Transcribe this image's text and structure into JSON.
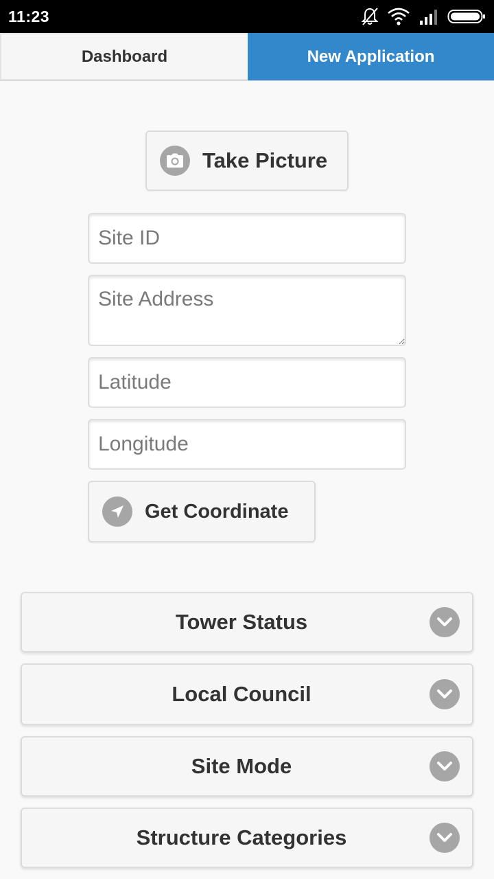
{
  "status_bar": {
    "time": "11:23",
    "icons": [
      "mute-bell-icon",
      "wifi-icon",
      "signal-icon",
      "battery-icon"
    ]
  },
  "tabs": [
    {
      "label": "Dashboard",
      "active": false
    },
    {
      "label": "New Application",
      "active": true
    }
  ],
  "form": {
    "take_picture_label": "Take Picture",
    "site_id_placeholder": "Site ID",
    "site_address_placeholder": "Site Address",
    "latitude_placeholder": "Latitude",
    "longitude_placeholder": "Longitude",
    "get_coordinate_label": "Get Coordinate"
  },
  "sections": [
    {
      "label": "Tower Status"
    },
    {
      "label": "Local Council"
    },
    {
      "label": "Site Mode"
    },
    {
      "label": "Structure Categories"
    }
  ],
  "colors": {
    "accent": "#3388cc",
    "icon_bg": "#a6a6a6",
    "button_bg": "#f6f6f6",
    "page_bg": "#f9f9f9"
  }
}
